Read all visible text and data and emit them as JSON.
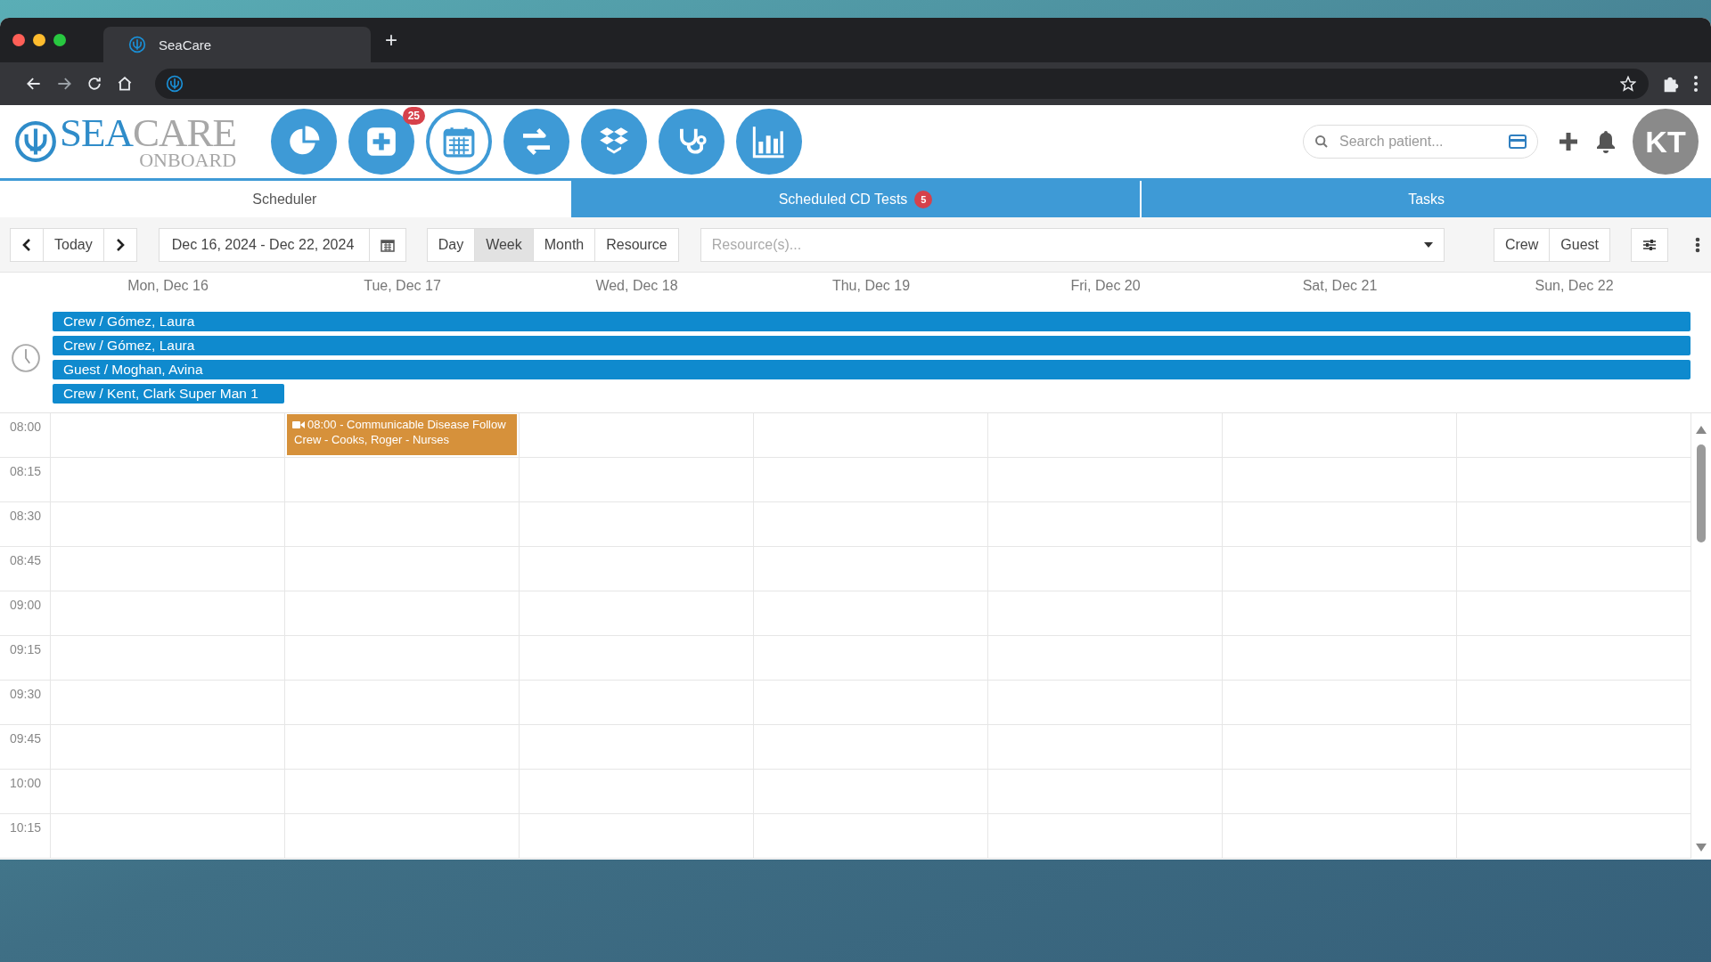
{
  "browser": {
    "tab_title": "SeaCare",
    "new_tab": "+"
  },
  "header": {
    "logo": {
      "first": "SEA",
      "second": "CARE",
      "tagline": "ONBOARD"
    },
    "nav_buttons": [
      {
        "kind": "dashboard",
        "selected": false
      },
      {
        "kind": "add",
        "badge": "25",
        "selected": false
      },
      {
        "kind": "calendar",
        "selected": true
      },
      {
        "kind": "transfer",
        "selected": false
      },
      {
        "kind": "inventory",
        "selected": false
      },
      {
        "kind": "medical",
        "selected": false
      },
      {
        "kind": "reports",
        "selected": false
      }
    ],
    "search": {
      "placeholder": "Search patient..."
    },
    "avatar": "KT"
  },
  "tabs": [
    {
      "label": "Scheduler",
      "selected": true
    },
    {
      "label": "Scheduled CD Tests",
      "badge": "5",
      "selected": false
    },
    {
      "label": "Tasks",
      "selected": false
    }
  ],
  "toolbar": {
    "today": "Today",
    "date_range": "Dec 16, 2024 - Dec 22, 2024",
    "views": [
      {
        "label": "Day",
        "selected": false
      },
      {
        "label": "Week",
        "selected": true
      },
      {
        "label": "Month",
        "selected": false
      },
      {
        "label": "Resource",
        "selected": false
      }
    ],
    "resource_filter": {
      "placeholder": "Resource(s)..."
    },
    "people_filters": [
      "Crew",
      "Guest"
    ]
  },
  "calendar": {
    "days": [
      {
        "label": "Mon, Dec 16"
      },
      {
        "label": "Tue, Dec 17",
        "events": [
          {
            "title": "08:00 - Communicable Disease Follow",
            "subtitle": "Crew - Cooks, Roger - Nurses",
            "kind": "video"
          }
        ]
      },
      {
        "label": "Wed, Dec 18"
      },
      {
        "label": "Thu, Dec 19"
      },
      {
        "label": "Fri, Dec 20"
      },
      {
        "label": "Sat, Dec 21"
      },
      {
        "label": "Sun, Dec 22"
      }
    ],
    "all_day_events": [
      {
        "label": "Crew / Gómez, Laura",
        "kind": "week"
      },
      {
        "label": "Crew / Gómez, Laura",
        "kind": "week"
      },
      {
        "label": "Guest / Moghan, Avina",
        "kind": "week"
      },
      {
        "label": "Crew / Kent, Clark Super Man 1",
        "kind": "day"
      }
    ],
    "time_slots": [
      "08:00",
      "08:15",
      "08:30",
      "08:45",
      "09:00",
      "09:15",
      "09:30",
      "09:45",
      "10:00",
      "10:15"
    ]
  }
}
